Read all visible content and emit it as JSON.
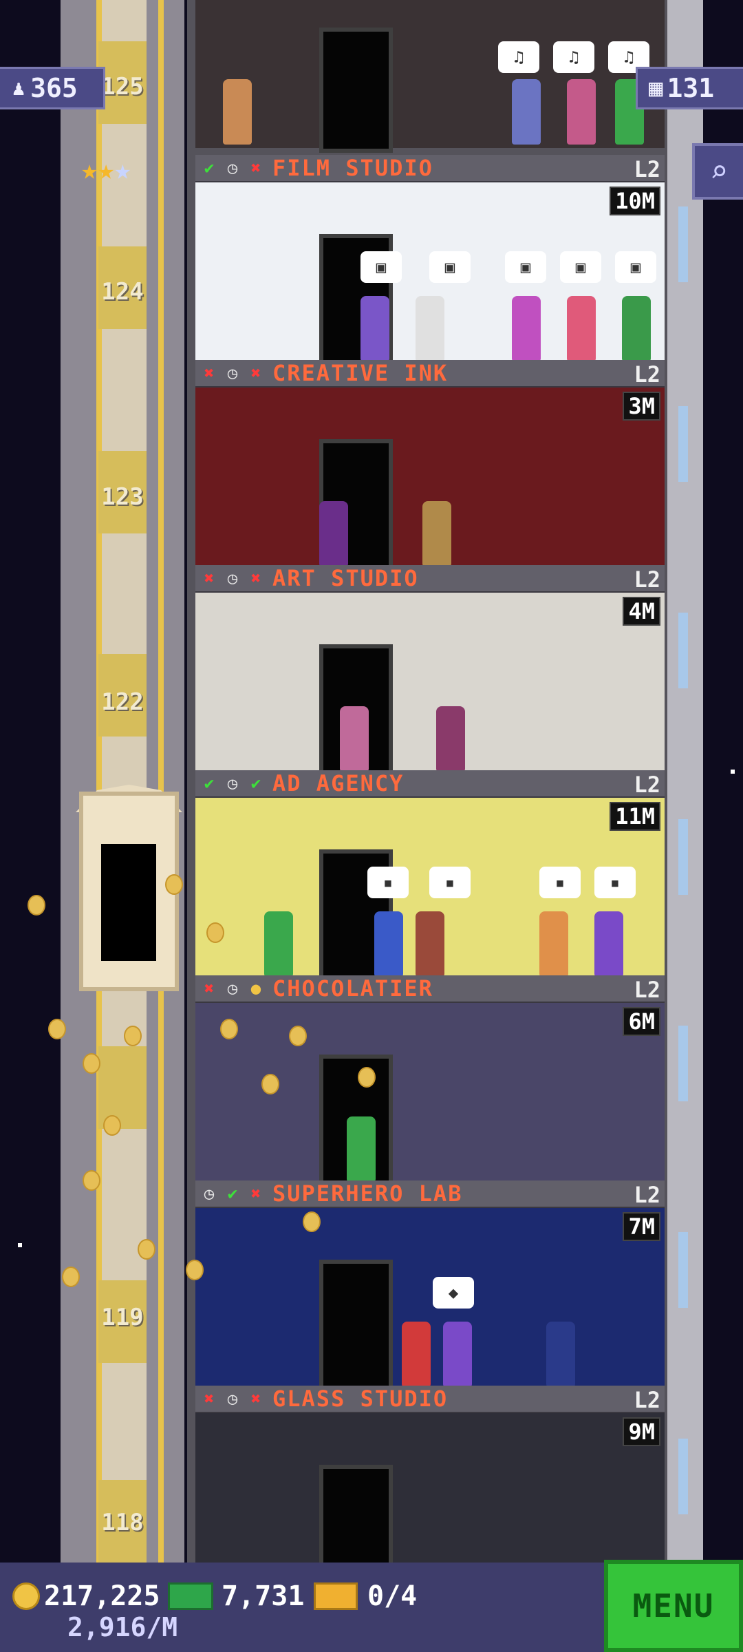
{
  "top_left_badge": {
    "icon": "population-icon",
    "value": "365"
  },
  "top_right_badge": {
    "icon": "floors-icon",
    "value": "131"
  },
  "search": {
    "icon": "magnifier-icon"
  },
  "rating_stars": {
    "filled": 2,
    "total": 3
  },
  "shaft_floor_numbers": [
    "125",
    "124",
    "123",
    "122",
    "119",
    "118"
  ],
  "floors": [
    {
      "name": "FILM STUDIO",
      "level": "L2",
      "stock": "10M",
      "status": [
        "ok",
        "clock",
        "no"
      ],
      "color": "#eef1f5"
    },
    {
      "name": "CREATIVE INK",
      "level": "L2",
      "stock": "3M",
      "status": [
        "no",
        "clock",
        "no"
      ],
      "color": "#6a1a1e"
    },
    {
      "name": "ART STUDIO",
      "level": "L2",
      "stock": "4M",
      "status": [
        "no",
        "clock",
        "no"
      ],
      "color": "#d9d6cf"
    },
    {
      "name": "AD AGENCY",
      "level": "L2",
      "stock": "11M",
      "status": [
        "ok",
        "clock",
        "ok"
      ],
      "color": "#e6e07a"
    },
    {
      "name": "CHOCOLATIER",
      "level": "L2",
      "stock": "6M",
      "status": [
        "no",
        "clock",
        "coin"
      ],
      "color": "#4a4668"
    },
    {
      "name": "SUPERHERO LAB",
      "level": "L2",
      "stock": "7M",
      "status": [
        "clock",
        "ok",
        "no"
      ],
      "color": "#1c2a70"
    },
    {
      "name": "GLASS STUDIO",
      "level": "L2",
      "stock": "9M",
      "status": [
        "no",
        "clock",
        "no"
      ],
      "color": "#2e2e38"
    }
  ],
  "bottom_bar": {
    "coins": "217,225",
    "bux": "7,731",
    "tickets": "0/4",
    "rate": "2,916/M",
    "menu_label": "MENU"
  }
}
